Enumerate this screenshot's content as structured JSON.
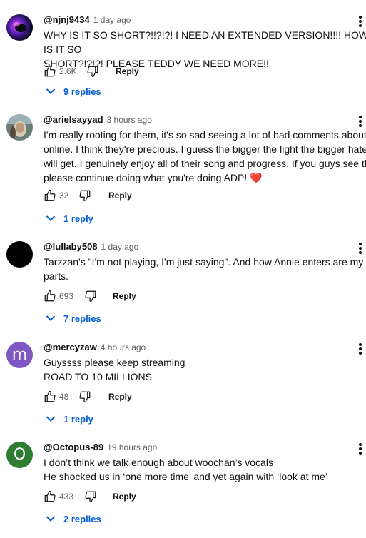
{
  "colors": {
    "link_blue": "#065fd4",
    "avatar_mercyzaw": "#7e57c2",
    "avatar_octopus": "#2e7d32",
    "avatar_lullaby": "#000000",
    "heart": "#e53935"
  },
  "icons": {
    "like": "thumbs-up-icon",
    "dislike": "thumbs-down-icon",
    "more": "more-vert-icon",
    "expand": "chevron-down-icon"
  },
  "comments": [
    {
      "handle": "@njnj9434",
      "time": "1 day ago",
      "text": "WHY IS IT SO SHORT?!!?!?! I NEED AN EXTENDED VERSION!!!! HOW IS IT SO\nSHORT?!?!?! PLEASE TEDDY WE NEED MORE!!",
      "likes": "2.6K",
      "reply_label": "Reply",
      "replies": "9 replies",
      "avatar_letter": ""
    },
    {
      "handle": "@arielsayyad",
      "time": "3 hours ago",
      "text": "I'm really rooting for them, it's so sad seeing a lot of bad comments about them\nonline. I think they're precious. I guess the bigger the light the bigger hate they\nwill get. I genuinely enjoy all of their song and progress. If you guys see this\nplease continue doing what you're doing ADP!",
      "emoji": "❤️",
      "likes": "32",
      "reply_label": "Reply",
      "replies": "1 reply",
      "avatar_letter": ""
    },
    {
      "handle": "@lullaby508",
      "time": "1 day ago",
      "text": "Tarzzan's \"I'm not playing, I'm just saying\". And how Annie enters are my favorite\nparts.",
      "likes": "693",
      "reply_label": "Reply",
      "replies": "7 replies",
      "avatar_letter": ""
    },
    {
      "handle": "@mercyzaw",
      "time": "4 hours ago",
      "text": "Guyssss please keep streaming\nROAD TO 10 MILLIONS",
      "likes": "48",
      "reply_label": "Reply",
      "replies": "1 reply",
      "avatar_letter": "m"
    },
    {
      "handle": "@Octopus-89",
      "time": "19 hours ago",
      "text": "I don’t think we talk enough about woochan’s vocals\nHe shocked us in ‘one more time’ and yet again with ‘look at me’",
      "likes": "433",
      "reply_label": "Reply",
      "replies": "2 replies",
      "avatar_letter": "O"
    }
  ]
}
